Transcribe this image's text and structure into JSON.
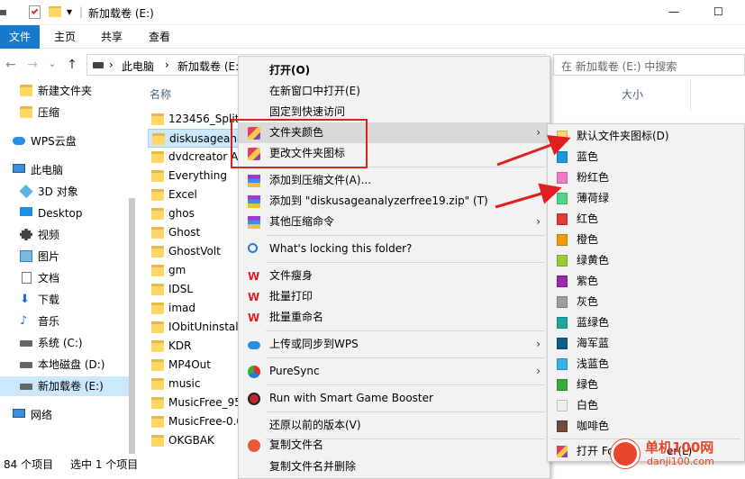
{
  "titlebar": {
    "title": "新加载卷 (E:)",
    "pipe": "|",
    "dropdown": "▾",
    "minimize": "—",
    "maximize": "☐"
  },
  "ribbon": {
    "tabs": [
      "文件",
      "主页",
      "共享",
      "查看"
    ]
  },
  "address": {
    "back": "←",
    "forward": "→",
    "recent": "⌄",
    "up": "↑",
    "crumbs": [
      "此电脑",
      "新加载卷 (E:"
    ],
    "separator": "›",
    "search_placeholder": "在 新加载卷 (E:) 中搜索"
  },
  "nav": {
    "items": [
      {
        "label": "新建文件夹",
        "icon": "folder-icon"
      },
      {
        "label": "压缩",
        "icon": "folder-icon"
      },
      {
        "label": "WPS云盘",
        "icon": "cloud-icon"
      },
      {
        "label": "此电脑",
        "icon": "computer-icon"
      },
      {
        "label": "3D 对象",
        "icon": "cube-icon"
      },
      {
        "label": "Desktop",
        "icon": "desktop-icon"
      },
      {
        "label": "视频",
        "icon": "video-icon"
      },
      {
        "label": "图片",
        "icon": "picture-icon"
      },
      {
        "label": "文档",
        "icon": "document-icon"
      },
      {
        "label": "下载",
        "icon": "download-icon"
      },
      {
        "label": "音乐",
        "icon": "music-icon"
      },
      {
        "label": "系统 (C:)",
        "icon": "drive-icon"
      },
      {
        "label": "本地磁盘 (D:)",
        "icon": "drive-icon"
      },
      {
        "label": "新加载卷 (E:)",
        "icon": "drive-icon"
      },
      {
        "label": "网络",
        "icon": "network-icon"
      }
    ]
  },
  "list": {
    "col_name": "名称",
    "col_size": "大小",
    "files": [
      "123456_Split",
      "diskusageana",
      "dvdcreator A",
      "Everything",
      "Excel",
      "ghos",
      "Ghost",
      "GhostVolt",
      "gm",
      "IDSL",
      "imad",
      "IObitUninstall",
      "KDR",
      "MP4Out",
      "music",
      "MusicFree_95",
      "MusicFree-0.0",
      "OKGBAK"
    ]
  },
  "status": {
    "count": "84 个项目",
    "selected": "选中 1 个项目"
  },
  "context_menu": {
    "items": [
      {
        "label": "打开(O)",
        "bold": true
      },
      {
        "label": "在新窗口中打开(E)"
      },
      {
        "label": "固定到快速访问"
      },
      {
        "label": "文件夹颜色",
        "arrow": "›",
        "icon": "paint-brush-icon",
        "highlight": true
      },
      {
        "label": "更改文件夹图标",
        "icon": "paint-brush-icon"
      },
      {
        "label": "添加到压缩文件(A)...",
        "icon": "winrar-icon"
      },
      {
        "label": "添加到 \"diskusageanalyzerfree19.zip\" (T)",
        "icon": "winrar-icon"
      },
      {
        "label": "其他压缩命令",
        "arrow": "›",
        "icon": "winrar-icon"
      },
      {
        "label": "What's locking this folder?",
        "icon": "search-icon"
      },
      {
        "label": "文件瘦身",
        "icon": "wps-icon"
      },
      {
        "label": "批量打印",
        "icon": "wps-icon"
      },
      {
        "label": "批量重命名",
        "icon": "wps-icon"
      },
      {
        "label": "上传或同步到WPS",
        "arrow": "›",
        "icon": "cloud-icon"
      },
      {
        "label": "PureSync",
        "arrow": "›",
        "icon": "sync-icon"
      },
      {
        "label": "Run with Smart Game Booster",
        "icon": "booster-icon"
      },
      {
        "label": "还原以前的版本(V)"
      },
      {
        "label": "复制文件名",
        "icon": "copy-name-icon"
      },
      {
        "label": "复制文件名并删除",
        "icon": "copy-name-icon"
      }
    ]
  },
  "color_submenu": {
    "items": [
      {
        "label": "默认文件夹图标(D)",
        "color": "#ffd766"
      },
      {
        "label": "蓝色",
        "color": "#1a9ad9"
      },
      {
        "label": "粉红色",
        "color": "#f07cc8"
      },
      {
        "label": "薄荷绿",
        "color": "#4fd68a"
      },
      {
        "label": "红色",
        "color": "#e53935"
      },
      {
        "label": "橙色",
        "color": "#f39c12"
      },
      {
        "label": "绿黄色",
        "color": "#9acd32"
      },
      {
        "label": "紫色",
        "color": "#9b27b0"
      },
      {
        "label": "灰色",
        "color": "#9e9e9e"
      },
      {
        "label": "蓝绿色",
        "color": "#1aa89c"
      },
      {
        "label": "海军蓝",
        "color": "#0d5f86"
      },
      {
        "label": "浅蓝色",
        "color": "#3ab0e8"
      },
      {
        "label": "绿色",
        "color": "#3aa83a"
      },
      {
        "label": "白色",
        "color": "#eeeeee"
      },
      {
        "label": "咖啡色",
        "color": "#6d4c41"
      }
    ],
    "footer": "打开 Fo",
    "footer_tail": "er(L)"
  },
  "watermark": {
    "line1": "单机100网",
    "line2": "danji100.com"
  },
  "colors": {
    "accent": "#1979ca",
    "selection": "#cce8ff",
    "annotation_red": "#e02020"
  }
}
